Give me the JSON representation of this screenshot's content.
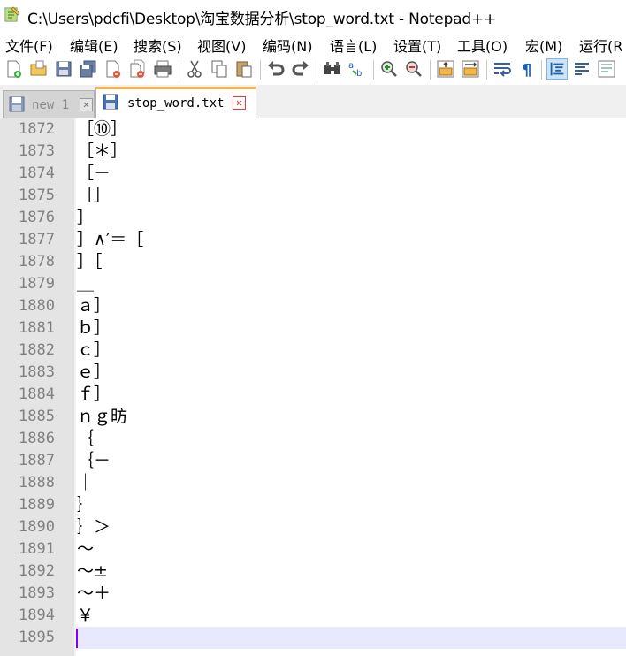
{
  "window": {
    "title": "C:\\Users\\pdcfi\\Desktop\\淘宝数据分析\\stop_word.txt - Notepad++"
  },
  "menu": [
    "文件(F)",
    "编辑(E)",
    "搜索(S)",
    "视图(V)",
    "编码(N)",
    "语言(L)",
    "设置(T)",
    "工具(O)",
    "宏(M)",
    "运行(R"
  ],
  "tabs": [
    {
      "label": "new 1",
      "active": false
    },
    {
      "label": "stop_word.txt",
      "active": true
    }
  ],
  "editor": {
    "lines": [
      {
        "no": "1872",
        "text": "［⑩］"
      },
      {
        "no": "1873",
        "text": "［＊］"
      },
      {
        "no": "1874",
        "text": "［－"
      },
      {
        "no": "1875",
        "text": "［］"
      },
      {
        "no": "1876",
        "text": "］"
      },
      {
        "no": "1877",
        "text": "］∧′＝［"
      },
      {
        "no": "1878",
        "text": "］［"
      },
      {
        "no": "1879",
        "text": "＿"
      },
      {
        "no": "1880",
        "text": "ａ］"
      },
      {
        "no": "1881",
        "text": "ｂ］"
      },
      {
        "no": "1882",
        "text": "ｃ］"
      },
      {
        "no": "1883",
        "text": "ｅ］"
      },
      {
        "no": "1884",
        "text": "ｆ］"
      },
      {
        "no": "1885",
        "text": "ｎｇ昉"
      },
      {
        "no": "1886",
        "text": "｛"
      },
      {
        "no": "1887",
        "text": "｛－"
      },
      {
        "no": "1888",
        "text": "｜"
      },
      {
        "no": "1889",
        "text": "｝"
      },
      {
        "no": "1890",
        "text": "｝＞"
      },
      {
        "no": "1891",
        "text": "～"
      },
      {
        "no": "1892",
        "text": "～±"
      },
      {
        "no": "1893",
        "text": "～＋"
      },
      {
        "no": "1894",
        "text": "￥"
      },
      {
        "no": "1895",
        "text": ""
      }
    ]
  },
  "colors": {
    "tab_accent": "#ffb045",
    "caret": "#8000ff",
    "current_line": "#e8e8ff"
  }
}
